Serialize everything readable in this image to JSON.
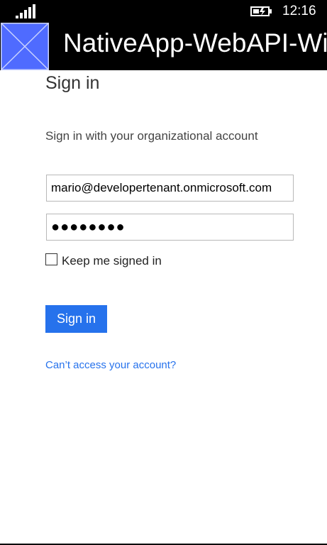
{
  "status_bar": {
    "time": "12:16",
    "signal_icon": "signal-strength-icon",
    "battery_icon": "battery-charging-icon"
  },
  "app_bar": {
    "title": "NativeApp-WebAPI-Win",
    "tile_icon": "placeholder-image-icon",
    "tile_color": "#4f6bff"
  },
  "form": {
    "heading": "Sign in",
    "subtitle": "Sign in with your organizational account",
    "email_value": "mario@developertenant.onmicrosoft.com",
    "password_value": "●●●●●●●●",
    "keep_signed_in_label": "Keep me signed in",
    "keep_signed_in_checked": false,
    "signin_button": "Sign in",
    "cant_access_link": "Can’t access your account?"
  },
  "colors": {
    "accent": "#2672ec",
    "bar_background": "#000000"
  }
}
